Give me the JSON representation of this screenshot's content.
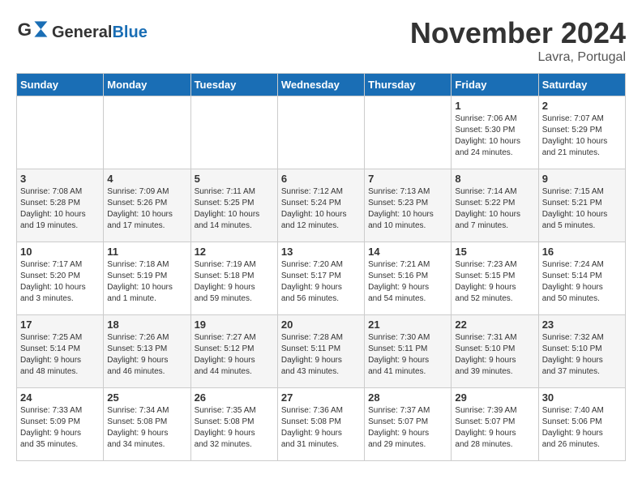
{
  "logo": {
    "text_general": "General",
    "text_blue": "Blue"
  },
  "header": {
    "month": "November 2024",
    "location": "Lavra, Portugal"
  },
  "weekdays": [
    "Sunday",
    "Monday",
    "Tuesday",
    "Wednesday",
    "Thursday",
    "Friday",
    "Saturday"
  ],
  "weeks": [
    [
      {
        "day": "",
        "info": ""
      },
      {
        "day": "",
        "info": ""
      },
      {
        "day": "",
        "info": ""
      },
      {
        "day": "",
        "info": ""
      },
      {
        "day": "",
        "info": ""
      },
      {
        "day": "1",
        "info": "Sunrise: 7:06 AM\nSunset: 5:30 PM\nDaylight: 10 hours\nand 24 minutes."
      },
      {
        "day": "2",
        "info": "Sunrise: 7:07 AM\nSunset: 5:29 PM\nDaylight: 10 hours\nand 21 minutes."
      }
    ],
    [
      {
        "day": "3",
        "info": "Sunrise: 7:08 AM\nSunset: 5:28 PM\nDaylight: 10 hours\nand 19 minutes."
      },
      {
        "day": "4",
        "info": "Sunrise: 7:09 AM\nSunset: 5:26 PM\nDaylight: 10 hours\nand 17 minutes."
      },
      {
        "day": "5",
        "info": "Sunrise: 7:11 AM\nSunset: 5:25 PM\nDaylight: 10 hours\nand 14 minutes."
      },
      {
        "day": "6",
        "info": "Sunrise: 7:12 AM\nSunset: 5:24 PM\nDaylight: 10 hours\nand 12 minutes."
      },
      {
        "day": "7",
        "info": "Sunrise: 7:13 AM\nSunset: 5:23 PM\nDaylight: 10 hours\nand 10 minutes."
      },
      {
        "day": "8",
        "info": "Sunrise: 7:14 AM\nSunset: 5:22 PM\nDaylight: 10 hours\nand 7 minutes."
      },
      {
        "day": "9",
        "info": "Sunrise: 7:15 AM\nSunset: 5:21 PM\nDaylight: 10 hours\nand 5 minutes."
      }
    ],
    [
      {
        "day": "10",
        "info": "Sunrise: 7:17 AM\nSunset: 5:20 PM\nDaylight: 10 hours\nand 3 minutes."
      },
      {
        "day": "11",
        "info": "Sunrise: 7:18 AM\nSunset: 5:19 PM\nDaylight: 10 hours\nand 1 minute."
      },
      {
        "day": "12",
        "info": "Sunrise: 7:19 AM\nSunset: 5:18 PM\nDaylight: 9 hours\nand 59 minutes."
      },
      {
        "day": "13",
        "info": "Sunrise: 7:20 AM\nSunset: 5:17 PM\nDaylight: 9 hours\nand 56 minutes."
      },
      {
        "day": "14",
        "info": "Sunrise: 7:21 AM\nSunset: 5:16 PM\nDaylight: 9 hours\nand 54 minutes."
      },
      {
        "day": "15",
        "info": "Sunrise: 7:23 AM\nSunset: 5:15 PM\nDaylight: 9 hours\nand 52 minutes."
      },
      {
        "day": "16",
        "info": "Sunrise: 7:24 AM\nSunset: 5:14 PM\nDaylight: 9 hours\nand 50 minutes."
      }
    ],
    [
      {
        "day": "17",
        "info": "Sunrise: 7:25 AM\nSunset: 5:14 PM\nDaylight: 9 hours\nand 48 minutes."
      },
      {
        "day": "18",
        "info": "Sunrise: 7:26 AM\nSunset: 5:13 PM\nDaylight: 9 hours\nand 46 minutes."
      },
      {
        "day": "19",
        "info": "Sunrise: 7:27 AM\nSunset: 5:12 PM\nDaylight: 9 hours\nand 44 minutes."
      },
      {
        "day": "20",
        "info": "Sunrise: 7:28 AM\nSunset: 5:11 PM\nDaylight: 9 hours\nand 43 minutes."
      },
      {
        "day": "21",
        "info": "Sunrise: 7:30 AM\nSunset: 5:11 PM\nDaylight: 9 hours\nand 41 minutes."
      },
      {
        "day": "22",
        "info": "Sunrise: 7:31 AM\nSunset: 5:10 PM\nDaylight: 9 hours\nand 39 minutes."
      },
      {
        "day": "23",
        "info": "Sunrise: 7:32 AM\nSunset: 5:10 PM\nDaylight: 9 hours\nand 37 minutes."
      }
    ],
    [
      {
        "day": "24",
        "info": "Sunrise: 7:33 AM\nSunset: 5:09 PM\nDaylight: 9 hours\nand 35 minutes."
      },
      {
        "day": "25",
        "info": "Sunrise: 7:34 AM\nSunset: 5:08 PM\nDaylight: 9 hours\nand 34 minutes."
      },
      {
        "day": "26",
        "info": "Sunrise: 7:35 AM\nSunset: 5:08 PM\nDaylight: 9 hours\nand 32 minutes."
      },
      {
        "day": "27",
        "info": "Sunrise: 7:36 AM\nSunset: 5:08 PM\nDaylight: 9 hours\nand 31 minutes."
      },
      {
        "day": "28",
        "info": "Sunrise: 7:37 AM\nSunset: 5:07 PM\nDaylight: 9 hours\nand 29 minutes."
      },
      {
        "day": "29",
        "info": "Sunrise: 7:39 AM\nSunset: 5:07 PM\nDaylight: 9 hours\nand 28 minutes."
      },
      {
        "day": "30",
        "info": "Sunrise: 7:40 AM\nSunset: 5:06 PM\nDaylight: 9 hours\nand 26 minutes."
      }
    ]
  ]
}
